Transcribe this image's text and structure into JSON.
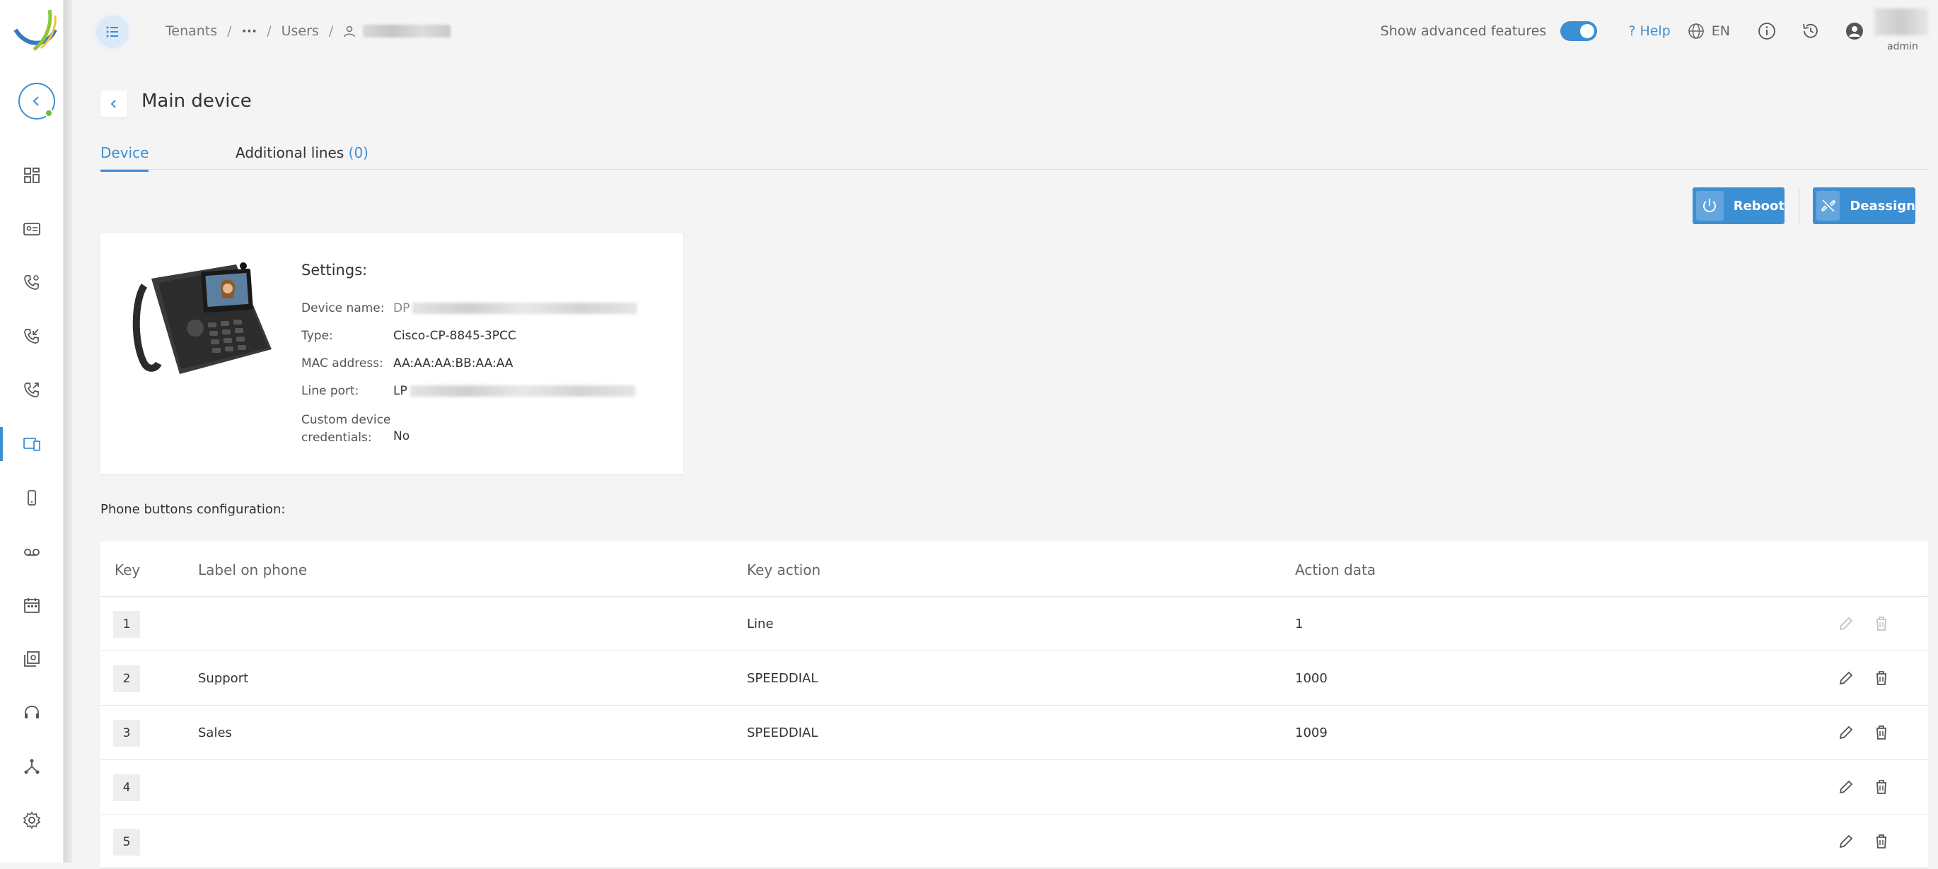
{
  "breadcrumb": {
    "tenants": "Tenants",
    "ellipsis": "···",
    "users": "Users"
  },
  "topbar": {
    "advanced_label": "Show advanced features",
    "help": "? Help",
    "lang": "EN",
    "user_role": "admin"
  },
  "page": {
    "title": "Main device"
  },
  "tabs": {
    "device": "Device",
    "additional": "Additional lines",
    "additional_count": "(0)"
  },
  "actions": {
    "reboot": "Reboot",
    "deassign": "Deassign"
  },
  "settings": {
    "title": "Settings:",
    "device_name_label": "Device name:",
    "device_name_prefix": "DP",
    "type_label": "Type:",
    "type_value": "Cisco-CP-8845-3PCC",
    "mac_label": "MAC address:",
    "mac_value": "AA:AA:AA:BB:AA:AA",
    "line_port_label": "Line port:",
    "line_port_prefix": "LP",
    "credentials_label_1": "Custom device",
    "credentials_label_2": "credentials:",
    "credentials_value": "No"
  },
  "buttons_config_title": "Phone buttons configuration:",
  "table": {
    "headers": {
      "key": "Key",
      "label": "Label on phone",
      "action": "Key action",
      "data": "Action data"
    },
    "rows": [
      {
        "key": "1",
        "label": "",
        "action": "Line",
        "data": "1"
      },
      {
        "key": "2",
        "label": "Support",
        "action": "SPEEDDIAL",
        "data": "1000"
      },
      {
        "key": "3",
        "label": "Sales",
        "action": "SPEEDDIAL",
        "data": "1009"
      },
      {
        "key": "4",
        "label": "",
        "action": "",
        "data": ""
      },
      {
        "key": "5",
        "label": "",
        "action": "",
        "data": ""
      }
    ]
  },
  "colors": {
    "accent": "#3d8fd4",
    "danger": "#c0392b"
  }
}
